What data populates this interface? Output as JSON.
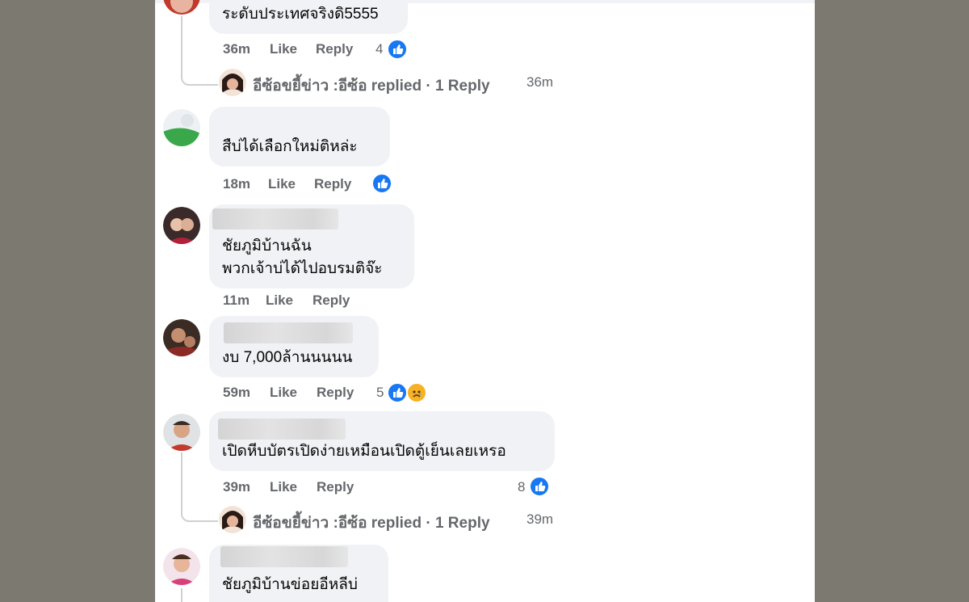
{
  "colors": {
    "page_bg": "#7b7970",
    "bubble": "#f0f2f5",
    "like_blue": "#1877f2",
    "meta_gray": "#65676b"
  },
  "actions": {
    "like": "Like",
    "reply": "Reply"
  },
  "comments": [
    {
      "text_lines": [
        "ระดับประเทศจริงดิ5555"
      ],
      "time": "36m",
      "reaction_count": "4",
      "reactions": [
        "like-icon"
      ]
    },
    {
      "text_lines": [
        "สืบ่ได้เลือกใหม่ติหล่ะ"
      ],
      "time": "18m",
      "reaction_count": "",
      "reactions": [
        "like-icon"
      ]
    },
    {
      "text_lines": [
        "ชัยภูมิบ้านฉัน",
        "พวกเจ้าบ่ได้ไปอบรมติจ๊ะ"
      ],
      "time": "11m",
      "reaction_count": "",
      "reactions": []
    },
    {
      "text_lines": [
        "งบ 7,000ล้านนนนน"
      ],
      "time": "59m",
      "reaction_count": "5",
      "reactions": [
        "like-icon",
        "sad-icon"
      ]
    },
    {
      "text_lines": [
        "เปิดหีบบัตรเปิดง่ายเหมือนเปิดตู้เย็นเลยเหรอ"
      ],
      "time": "39m",
      "reaction_count": "8",
      "reactions": [
        "like-icon"
      ]
    },
    {
      "text_lines": [
        "ชัยภูมิบ้านข่อยอีหลีบ่"
      ],
      "time": "",
      "reaction_count": "",
      "reactions": []
    }
  ],
  "replies": [
    {
      "label": "อีซ้อขยี้ข่าว :อีซ้อ replied · 1 Reply",
      "time": "36m"
    },
    {
      "label": "อีซ้อขยี้ข่าว :อีซ้อ replied · 1 Reply",
      "time": "39m"
    }
  ]
}
